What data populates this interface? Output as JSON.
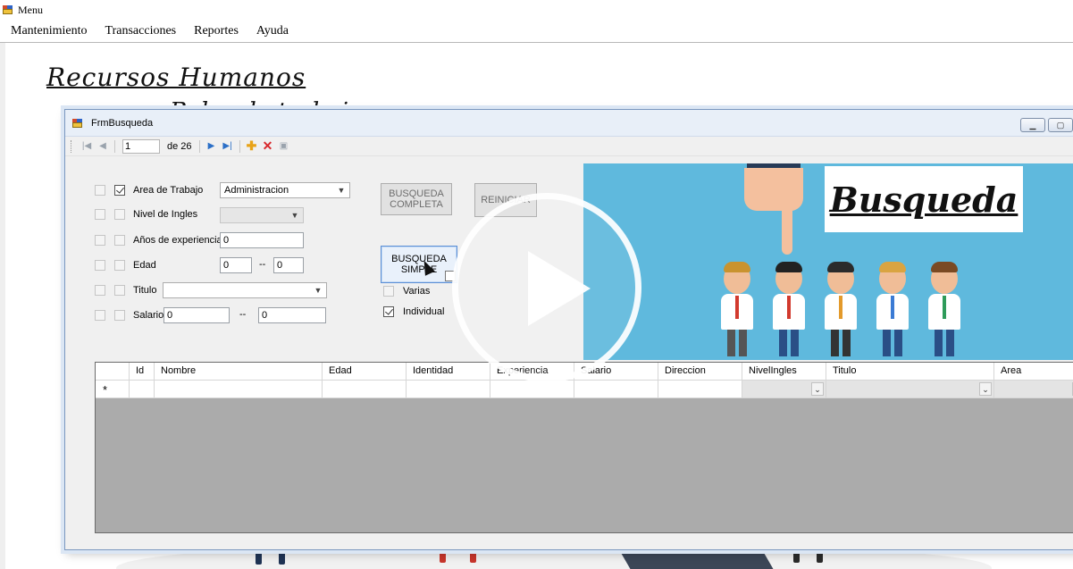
{
  "window": {
    "title": "Menu"
  },
  "menu": {
    "items": [
      "Mantenimiento",
      "Transacciones",
      "Reportes",
      "Ayuda"
    ]
  },
  "background": {
    "heading": "Recursos Humanos",
    "subheading": "Bolsa de trabajo"
  },
  "form": {
    "title": "FrmBusqueda",
    "window_buttons": [
      "minimize-icon",
      "maximize-icon"
    ],
    "navigator": {
      "position": "1",
      "of_label": "de 26"
    },
    "criteria": [
      {
        "label": "Area de Trabajo",
        "checked": true,
        "value": "Administracion"
      },
      {
        "label": "Nivel de Ingles",
        "checked": false,
        "value": ""
      },
      {
        "label": "Años de experiencia",
        "checked": false,
        "value": "0"
      },
      {
        "label": "Edad",
        "checked": false,
        "from": "0",
        "to": "0",
        "separator": "--"
      },
      {
        "label": "Titulo",
        "checked": false,
        "value": ""
      },
      {
        "label": "Salario",
        "checked": false,
        "from": "0",
        "to": "0",
        "separator": "--"
      }
    ],
    "buttons": {
      "busqueda_completa": "BUSQUEDA COMPLETA",
      "reiniciar": "REINICIAR",
      "busqueda_simple": "BUSQUEDA SIMPLE"
    },
    "options": [
      {
        "label": "Varias",
        "checked": false
      },
      {
        "label": "Individual",
        "checked": true
      }
    ],
    "banner": {
      "text": "Busqueda",
      "colors": {
        "sky": "#5fb9dd",
        "skin": "#f4c09e"
      }
    },
    "grid": {
      "columns": [
        "",
        "Id",
        "Nombre",
        "Edad",
        "Identidad",
        "Experiencia",
        "Salario",
        "Direccion",
        "NivelIngles",
        "Titulo",
        "Area"
      ],
      "new_row_marker": "*"
    }
  },
  "overlay": {
    "icon": "play-icon"
  }
}
